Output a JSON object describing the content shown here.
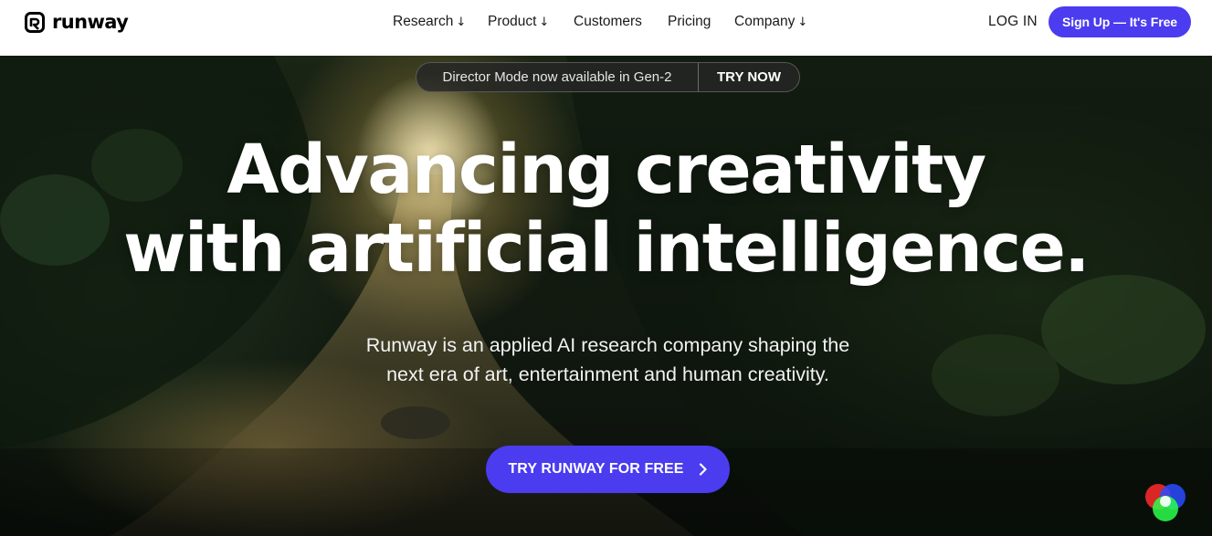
{
  "header": {
    "logo_text": "runway",
    "nav": [
      {
        "label": "Research",
        "arrow": "↓"
      },
      {
        "label": "Product",
        "arrow": "↓"
      },
      {
        "label": "Customers",
        "arrow": ""
      },
      {
        "label": "Pricing",
        "arrow": ""
      },
      {
        "label": "Company",
        "arrow": "↓"
      }
    ],
    "login_label": "LOG IN",
    "signup_label": "Sign Up — It's Free"
  },
  "hero": {
    "banner_text": "Director Mode now available in Gen-2",
    "banner_cta": "TRY NOW",
    "headline_line1": "Advancing creativity",
    "headline_line2": "with artificial intelligence.",
    "subhead_line1": "Runway is an applied AI research company shaping the",
    "subhead_line2": "next era of art, entertainment and human creativity.",
    "cta_label": "TRY RUNWAY FOR FREE"
  },
  "icons": {
    "logo": "runway-logo-icon",
    "chevron": "chevron-right-icon",
    "badge": "rgb-circles-icon"
  },
  "colors": {
    "accent": "#4b3cf0",
    "header_bg": "#ffffff",
    "hero_text": "#ffffff"
  }
}
